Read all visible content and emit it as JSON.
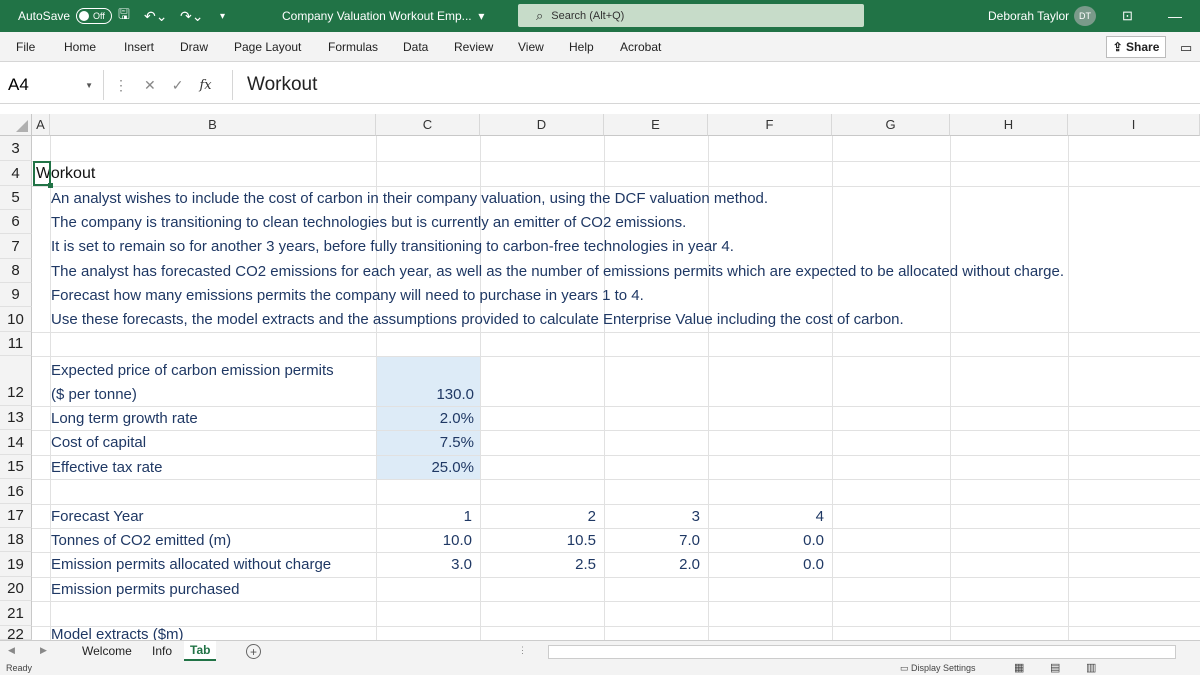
{
  "titlebar": {
    "autosave_label": "AutoSave",
    "autosave_state": "Off",
    "doc_title": "Company Valuation Workout Emp...",
    "search_placeholder": "Search (Alt+Q)",
    "user_name": "Deborah Taylor",
    "user_initials": "DT",
    "bg_color": "#217346"
  },
  "ribbon": {
    "tabs": [
      "File",
      "Home",
      "Insert",
      "Draw",
      "Page Layout",
      "Formulas",
      "Data",
      "Review",
      "View",
      "Help",
      "Acrobat"
    ],
    "share_label": "Share"
  },
  "formula_bar": {
    "name_box": "A4",
    "content": "Workout"
  },
  "columns": [
    "A",
    "B",
    "C",
    "D",
    "E",
    "F",
    "G",
    "H",
    "I"
  ],
  "rows": [
    "3",
    "4",
    "5",
    "6",
    "7",
    "8",
    "9",
    "10",
    "11",
    "12",
    "13",
    "14",
    "15",
    "16",
    "17",
    "18",
    "19",
    "20",
    "21",
    "22"
  ],
  "sheet": {
    "title": "Workout",
    "description": [
      "An analyst wishes to include the cost of carbon in their company valuation, using the DCF valuation method.",
      "The company is transitioning to clean technologies but is currently an emitter of CO2 emissions.",
      "It is set to remain so for another 3 years, before fully transitioning to carbon-free technologies in year 4.",
      "The analyst has forecasted CO2 emissions for each year, as well as the number of emissions permits which are expected to be allocated without charge.",
      "Forecast how many emissions permits the company will need to purchase in years 1 to 4.",
      "Use these forecasts, the model extracts and the assumptions provided to calculate Enterprise Value including the cost of carbon."
    ],
    "assumptions": [
      {
        "label_line1": "Expected price of carbon emission permits",
        "label_line2": "($ per tonne)",
        "value": "130.0"
      },
      {
        "label": "Long term growth rate",
        "value": "2.0%"
      },
      {
        "label": "Cost of capital",
        "value": "7.5%"
      },
      {
        "label": "Effective tax rate",
        "value": "25.0%"
      }
    ],
    "forecast": {
      "year_label": "Forecast Year",
      "years": [
        "1",
        "2",
        "3",
        "4"
      ],
      "emitted_label": "Tonnes of CO2 emitted (m)",
      "emitted": [
        "10.0",
        "10.5",
        "7.0",
        "0.0"
      ],
      "allocated_label": "Emission permits allocated without charge",
      "allocated": [
        "3.0",
        "2.5",
        "2.0",
        "0.0"
      ],
      "purchased_label": "Emission permits purchased"
    },
    "model_extracts": "Model extracts ($m)"
  },
  "sheet_tabs": [
    "Welcome",
    "Info",
    "Tab"
  ],
  "status": {
    "ready": "Ready",
    "display_settings": "Display Settings"
  },
  "colors": {
    "accent": "#217346",
    "input_fill": "#ddebf7",
    "text_blue": "#1f3864"
  }
}
